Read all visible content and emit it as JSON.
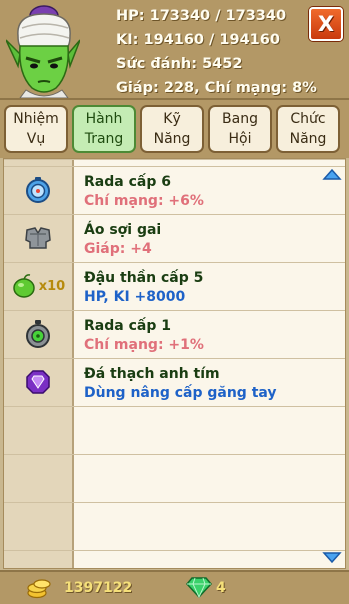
{
  "stats": {
    "hp": "HP: 173340 / 173340",
    "ki": "KI: 194160 / 194160",
    "attack": "Sức đánh: 5452",
    "defense": "Giáp: 228, Chí mạng: 8%"
  },
  "close_label": "X",
  "tabs": [
    {
      "line1": "Nhiệm",
      "line2": "Vụ"
    },
    {
      "line1": "Hành",
      "line2": "Trang"
    },
    {
      "line1": "Kỹ",
      "line2": "Năng"
    },
    {
      "line1": "Bang",
      "line2": "Hội"
    },
    {
      "line1": "Chức",
      "line2": "Năng"
    }
  ],
  "items": [
    {
      "icon": "radar-blue-icon",
      "qty": "",
      "name": "Rada cấp 6",
      "effect": "Chí mạng: +6%",
      "effect_color": "#e0707a"
    },
    {
      "icon": "thorn-armor-icon",
      "qty": "",
      "name": "Áo sợi gai",
      "effect": "Giáp: +4",
      "effect_color": "#e0707a"
    },
    {
      "icon": "senzu-bean-icon",
      "qty": "x10",
      "name": "Đậu thần cấp 5",
      "effect": "HP, KI +8000",
      "effect_color": "#1e62c8"
    },
    {
      "icon": "radar-grey-icon",
      "qty": "",
      "name": "Rada cấp 1",
      "effect": "Chí mạng: +1%",
      "effect_color": "#e0707a"
    },
    {
      "icon": "amethyst-icon",
      "qty": "",
      "name": "Đá thạch anh tím",
      "effect": "Dùng nâng cấp găng tay",
      "effect_color": "#1e62c8"
    }
  ],
  "footer": {
    "gold": "1397122",
    "gems": "4"
  }
}
